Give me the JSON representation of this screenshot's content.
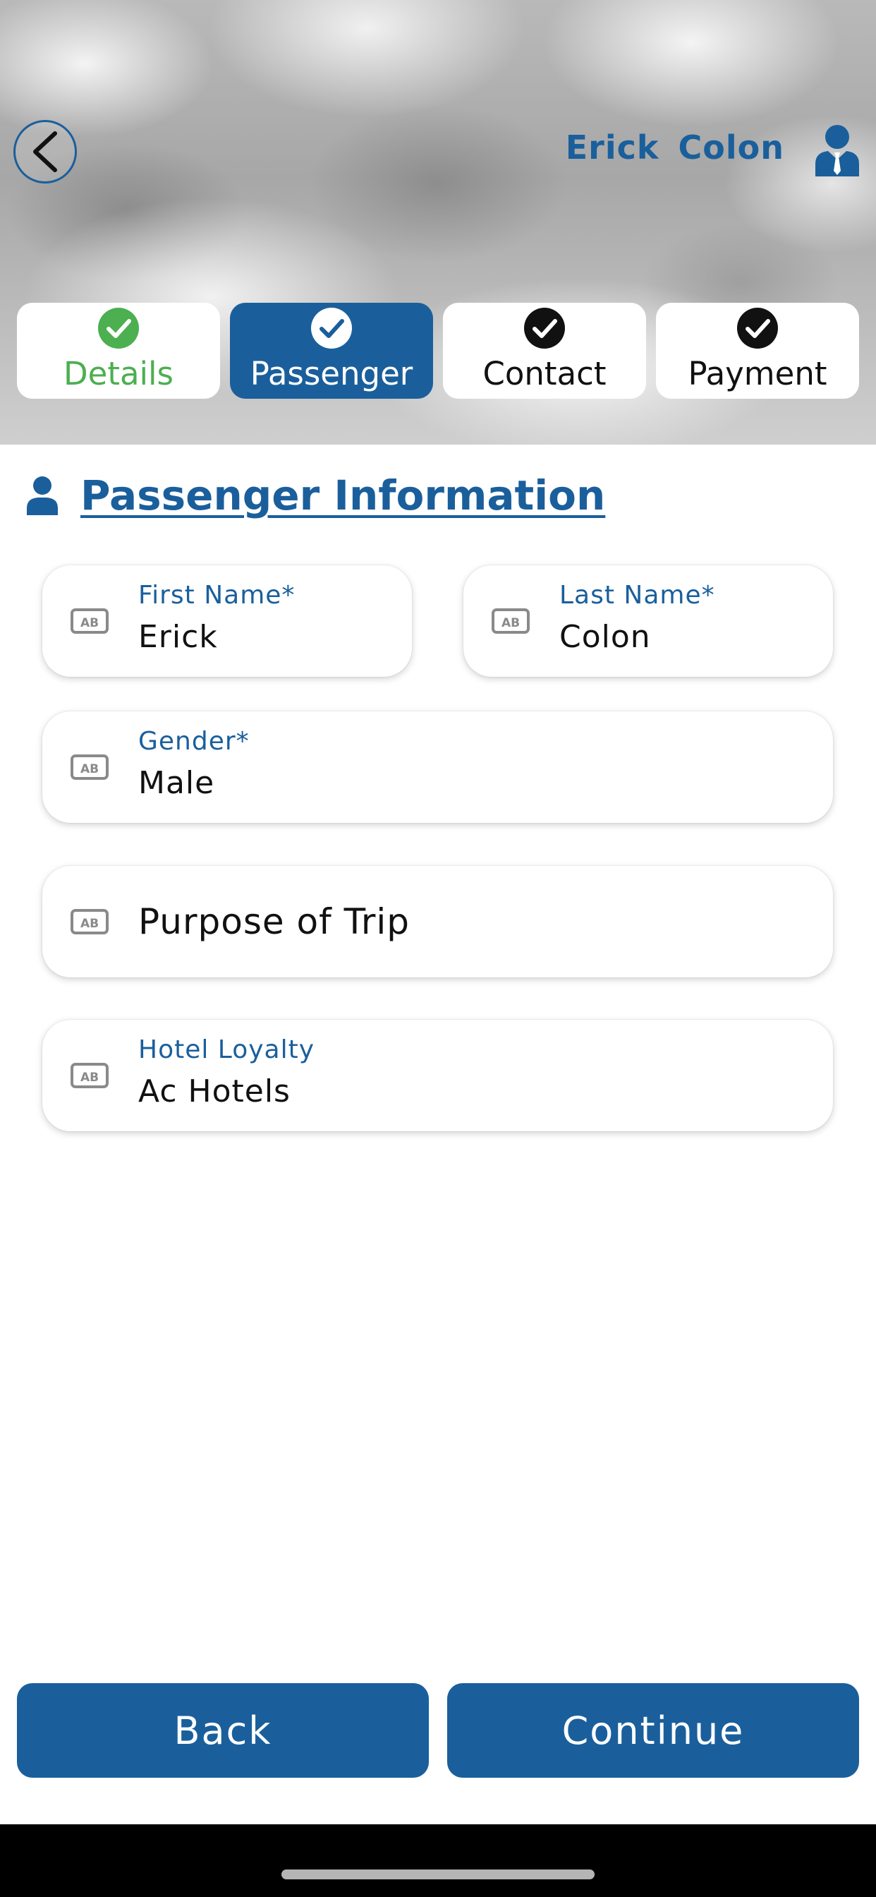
{
  "header": {
    "user_first_name": "Erick",
    "user_last_name": "Colon",
    "back_icon": "chevron-left-icon",
    "avatar_icon": "business-person-icon"
  },
  "steps": [
    {
      "label": "Details",
      "state": "done",
      "icon": "check-circle-icon",
      "color": "#4caf50"
    },
    {
      "label": "Passenger",
      "state": "active",
      "icon": "check-circle-icon",
      "color": "#ffffff"
    },
    {
      "label": "Contact",
      "state": "pending",
      "icon": "check-circle-icon",
      "color": "#111111"
    },
    {
      "label": "Payment",
      "state": "pending",
      "icon": "check-circle-icon",
      "color": "#111111"
    }
  ],
  "section": {
    "title": "Passenger Information",
    "icon": "person-icon"
  },
  "form": {
    "first_name": {
      "label": "First Name*",
      "value": "Erick",
      "icon": "ab-text-icon"
    },
    "last_name": {
      "label": "Last Name*",
      "value": "Colon",
      "icon": "ab-text-icon"
    },
    "gender": {
      "label": "Gender*",
      "value": "Male",
      "icon": "ab-text-icon"
    },
    "purpose": {
      "placeholder": "Purpose of Trip",
      "icon": "ab-text-icon"
    },
    "hotel_loyalty": {
      "label": "Hotel Loyalty",
      "value": "Ac Hotels",
      "icon": "ab-text-icon"
    }
  },
  "actions": {
    "back_label": "Back",
    "continue_label": "Continue"
  },
  "colors": {
    "brand": "#1a5f9c",
    "success": "#4caf50",
    "text": "#111111"
  }
}
